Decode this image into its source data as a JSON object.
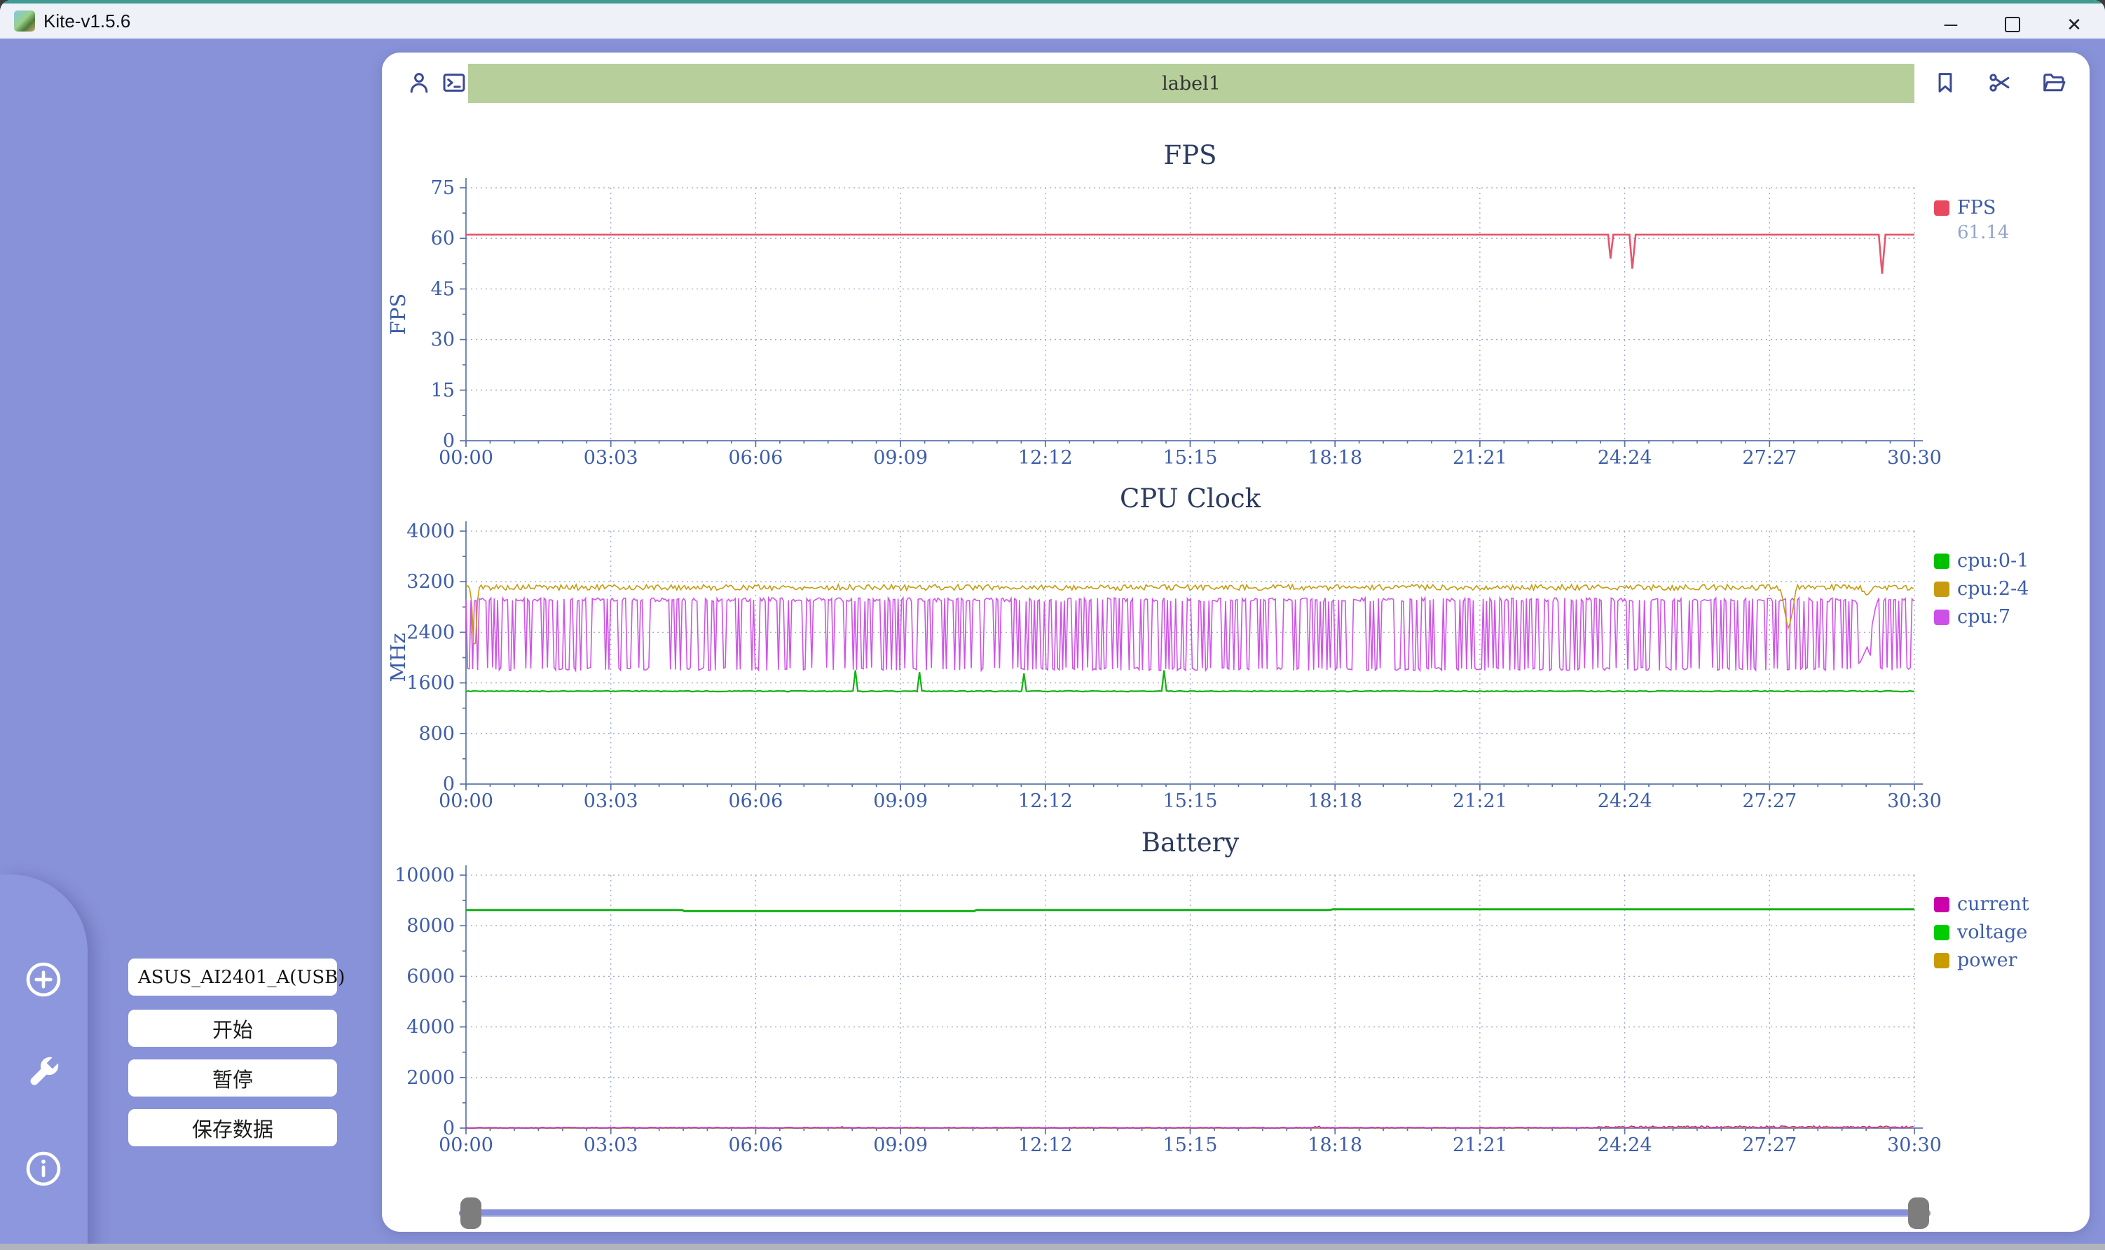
{
  "window": {
    "title": "Kite-v1.5.6",
    "controls": [
      "minimize-icon",
      "maximize-icon",
      "close-icon"
    ]
  },
  "toolbar": {
    "label_value": "label1",
    "left_icons": [
      "user-icon",
      "terminal-icon"
    ],
    "right_icons": [
      "bookmark-icon",
      "scissors-icon",
      "folder-icon"
    ]
  },
  "sidebar": {
    "rail_icons": [
      "add-circle-icon",
      "wrench-icon",
      "info-icon"
    ],
    "device_select": {
      "value": "ASUS_AI2401_A(USB)"
    },
    "buttons": {
      "start": "开始",
      "pause": "暂停",
      "save": "保存数据"
    }
  },
  "colors": {
    "app_background": "#8892d8",
    "titlebar": "#eff1f8",
    "titlebar_accent": "#3f9a92",
    "label_field": "#b7cf9b",
    "icon_navy": "#3b4a94",
    "axis_blue": "#3d5da8",
    "fps_red": "#e4566b",
    "green": "#12b212",
    "gold": "#c89b10",
    "magenta": "#cf54e8",
    "current_magenta": "#bb22bb"
  },
  "chart_data": [
    {
      "type": "line",
      "title": "FPS",
      "ylabel": "FPS",
      "xlim": [
        0,
        30.5
      ],
      "ylim": [
        0,
        75
      ],
      "yticks": [
        0,
        15,
        30,
        45,
        60,
        75
      ],
      "xtick_labels": [
        "00:00",
        "03:03",
        "06:06",
        "09:09",
        "12:12",
        "15:15",
        "18:18",
        "21:21",
        "24:24",
        "27:27",
        "30:30"
      ],
      "grid": "dotted",
      "legend_position": "right",
      "legend": [
        {
          "label": "FPS",
          "value": "61.14",
          "color": "#e8495f"
        }
      ],
      "series": [
        {
          "name": "FPS",
          "color": "#e4566b",
          "width": 2.6,
          "points": [
            [
              0,
              61.1
            ],
            [
              24.05,
              61.1
            ],
            [
              24.1,
              54
            ],
            [
              24.16,
              61.1
            ],
            [
              24.5,
              61.1
            ],
            [
              24.56,
              51
            ],
            [
              24.63,
              61.1
            ],
            [
              29.75,
              61.1
            ],
            [
              29.82,
              49.5
            ],
            [
              29.89,
              61.1
            ],
            [
              30.5,
              61.1
            ]
          ]
        }
      ]
    },
    {
      "type": "line",
      "title": "CPU Clock",
      "ylabel": "MHz",
      "xlim": [
        0,
        30.5
      ],
      "ylim": [
        0,
        4000
      ],
      "yticks": [
        0,
        800,
        1600,
        2400,
        3200,
        4000
      ],
      "xtick_labels": [
        "00:00",
        "03:03",
        "06:06",
        "09:09",
        "12:12",
        "15:15",
        "18:18",
        "21:21",
        "24:24",
        "27:27",
        "30:30"
      ],
      "grid": "dotted",
      "legend_position": "right",
      "legend": [
        {
          "label": "cpu:0-1",
          "color": "#00c000"
        },
        {
          "label": "cpu:2-4",
          "color": "#c89b0e"
        },
        {
          "label": "cpu:7",
          "color": "#cc4fe8"
        }
      ],
      "series": [
        {
          "name": "cpu:7",
          "color": "#cf54e8",
          "width": 1.6,
          "pattern": {
            "kind": "square",
            "t0": 0,
            "t1": 30.5,
            "dt": 0.035,
            "low": 1795,
            "high": 2945,
            "duty": 0.6,
            "hj": 60,
            "lj": 50,
            "seed": 11
          },
          "dips": [
            [
              29.5,
              2150,
              0.45
            ]
          ]
        },
        {
          "name": "cpu:2-4",
          "color": "#c89b10",
          "width": 1.6,
          "pattern": {
            "kind": "noise",
            "t0": 0,
            "t1": 30.5,
            "dt": 0.04,
            "base": 3110,
            "amp": 45,
            "seed": 5
          },
          "dips": [
            [
              0.18,
              1900,
              0.15
            ],
            [
              27.85,
              2420,
              0.35
            ],
            [
              29.5,
              2980,
              0.3
            ]
          ]
        },
        {
          "name": "cpu:0-1",
          "color": "#12b212",
          "width": 2.2,
          "pattern": {
            "kind": "noise",
            "t0": 0,
            "t1": 30.5,
            "dt": 0.05,
            "base": 1468,
            "amp": 7,
            "seed": 9
          },
          "dips": [
            [
              8.2,
              1800,
              0.1
            ],
            [
              9.55,
              1770,
              0.1
            ],
            [
              11.75,
              1750,
              0.1
            ],
            [
              14.7,
              1800,
              0.1
            ]
          ]
        }
      ]
    },
    {
      "type": "line",
      "title": "Battery",
      "ylabel": "",
      "xlim": [
        0,
        30.5
      ],
      "ylim": [
        0,
        10000
      ],
      "yticks": [
        0,
        2000,
        4000,
        6000,
        8000,
        10000
      ],
      "xtick_labels": [
        "00:00",
        "03:03",
        "06:06",
        "09:09",
        "12:12",
        "15:15",
        "18:18",
        "21:21",
        "24:24",
        "27:27",
        "30:30"
      ],
      "grid": "dotted",
      "legend_position": "right",
      "legend": [
        {
          "label": "current",
          "color": "#cc00aa"
        },
        {
          "label": "voltage",
          "color": "#00cc00"
        },
        {
          "label": "power",
          "color": "#c89b00"
        }
      ],
      "series": [
        {
          "name": "power",
          "color": "#c89b10",
          "width": 1.5,
          "pattern": {
            "kind": "noise",
            "t0": 0,
            "t1": 30.5,
            "dt": 0.03,
            "base": 5,
            "amp": 8,
            "min": 0,
            "seed": 21,
            "bursts": [
              [
                23.8,
                30.5,
                30
              ]
            ]
          }
        },
        {
          "name": "current",
          "color": "#bb22bb",
          "width": 1.5,
          "pattern": {
            "kind": "noise",
            "t0": 0,
            "t1": 30.5,
            "dt": 0.03,
            "base": 12,
            "amp": 15,
            "min": 0,
            "seed": 13,
            "bursts": [
              [
                7.85,
                7.98,
                60
              ],
              [
                17.85,
                17.98,
                60
              ],
              [
                23.8,
                30.5,
                65
              ]
            ]
          }
        },
        {
          "name": "voltage",
          "color": "#12b212",
          "width": 3,
          "points": [
            [
              0,
              8620
            ],
            [
              4.55,
              8620
            ],
            [
              4.6,
              8575
            ],
            [
              10.7,
              8575
            ],
            [
              10.75,
              8620
            ],
            [
              18.2,
              8620
            ],
            [
              18.25,
              8650
            ],
            [
              30.5,
              8650
            ]
          ]
        }
      ]
    }
  ]
}
